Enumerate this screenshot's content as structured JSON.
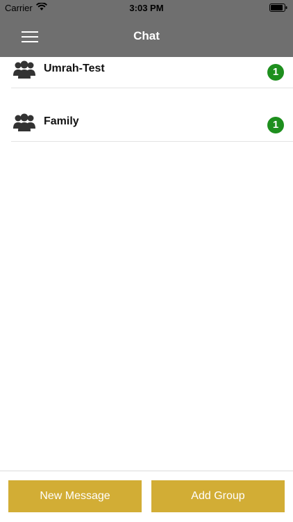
{
  "status_bar": {
    "carrier": "Carrier",
    "time": "3:03 PM",
    "wifi_icon": "wifi-icon",
    "battery_icon": "battery-icon"
  },
  "header": {
    "title": "Chat",
    "menu_icon": "hamburger-menu-icon",
    "background_color": "#6f6f6f"
  },
  "chats": [
    {
      "name": "Umrah-Test",
      "unread": "1",
      "icon": "group-icon"
    },
    {
      "name": "Family",
      "unread": "1",
      "icon": "group-icon"
    }
  ],
  "footer": {
    "new_message_label": "New Message",
    "add_group_label": "Add Group",
    "button_color": "#d2ad35",
    "badge_color": "#1e8f1e"
  }
}
